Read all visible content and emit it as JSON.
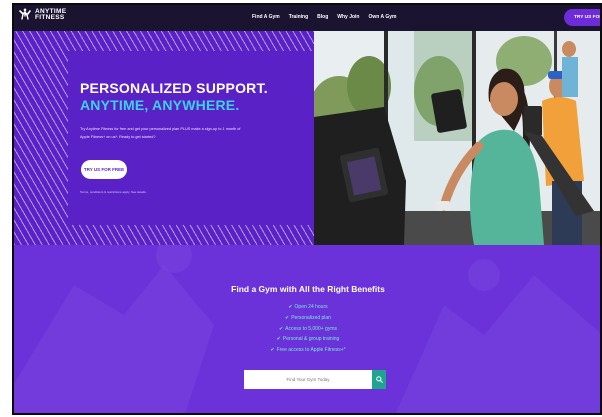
{
  "brand": {
    "name_line1": "ANYTIME",
    "name_line2": "FITNESS",
    "logo_icon": "running-man-icon"
  },
  "nav": {
    "links": [
      "Find A Gym",
      "Training",
      "Blog",
      "Why Join",
      "Own A Gym"
    ],
    "cta": "TRY US FOR FRE"
  },
  "hero": {
    "title_line1": "PERSONALIZED SUPPORT.",
    "title_line2": "ANYTIME, ANYWHERE.",
    "body": "Try Anytime Fitness for free and get your personalized plan PLUS make a sign-up to 1 month of Apple Fitness+ on us*. Ready to get started?",
    "button": "TRY US FOR FREE",
    "terms": "Terms, conditions & restrictions apply. See details.",
    "colors": {
      "panel": "#5a21c6",
      "accent": "#39d3e6"
    }
  },
  "find": {
    "title": "Find a Gym with All the Right Benefits",
    "benefits": [
      "Open 24 hours",
      "Personalized plan",
      "Access to 5,000+ gyms",
      "Personal & group training",
      "Free access to Apple Fitness+*"
    ],
    "search_placeholder": "Find Your Gym Today",
    "search_icon": "search-icon",
    "colors": {
      "background": "#6a32d8",
      "check": "#7de8d8",
      "search_button": "#1fa48f"
    }
  }
}
